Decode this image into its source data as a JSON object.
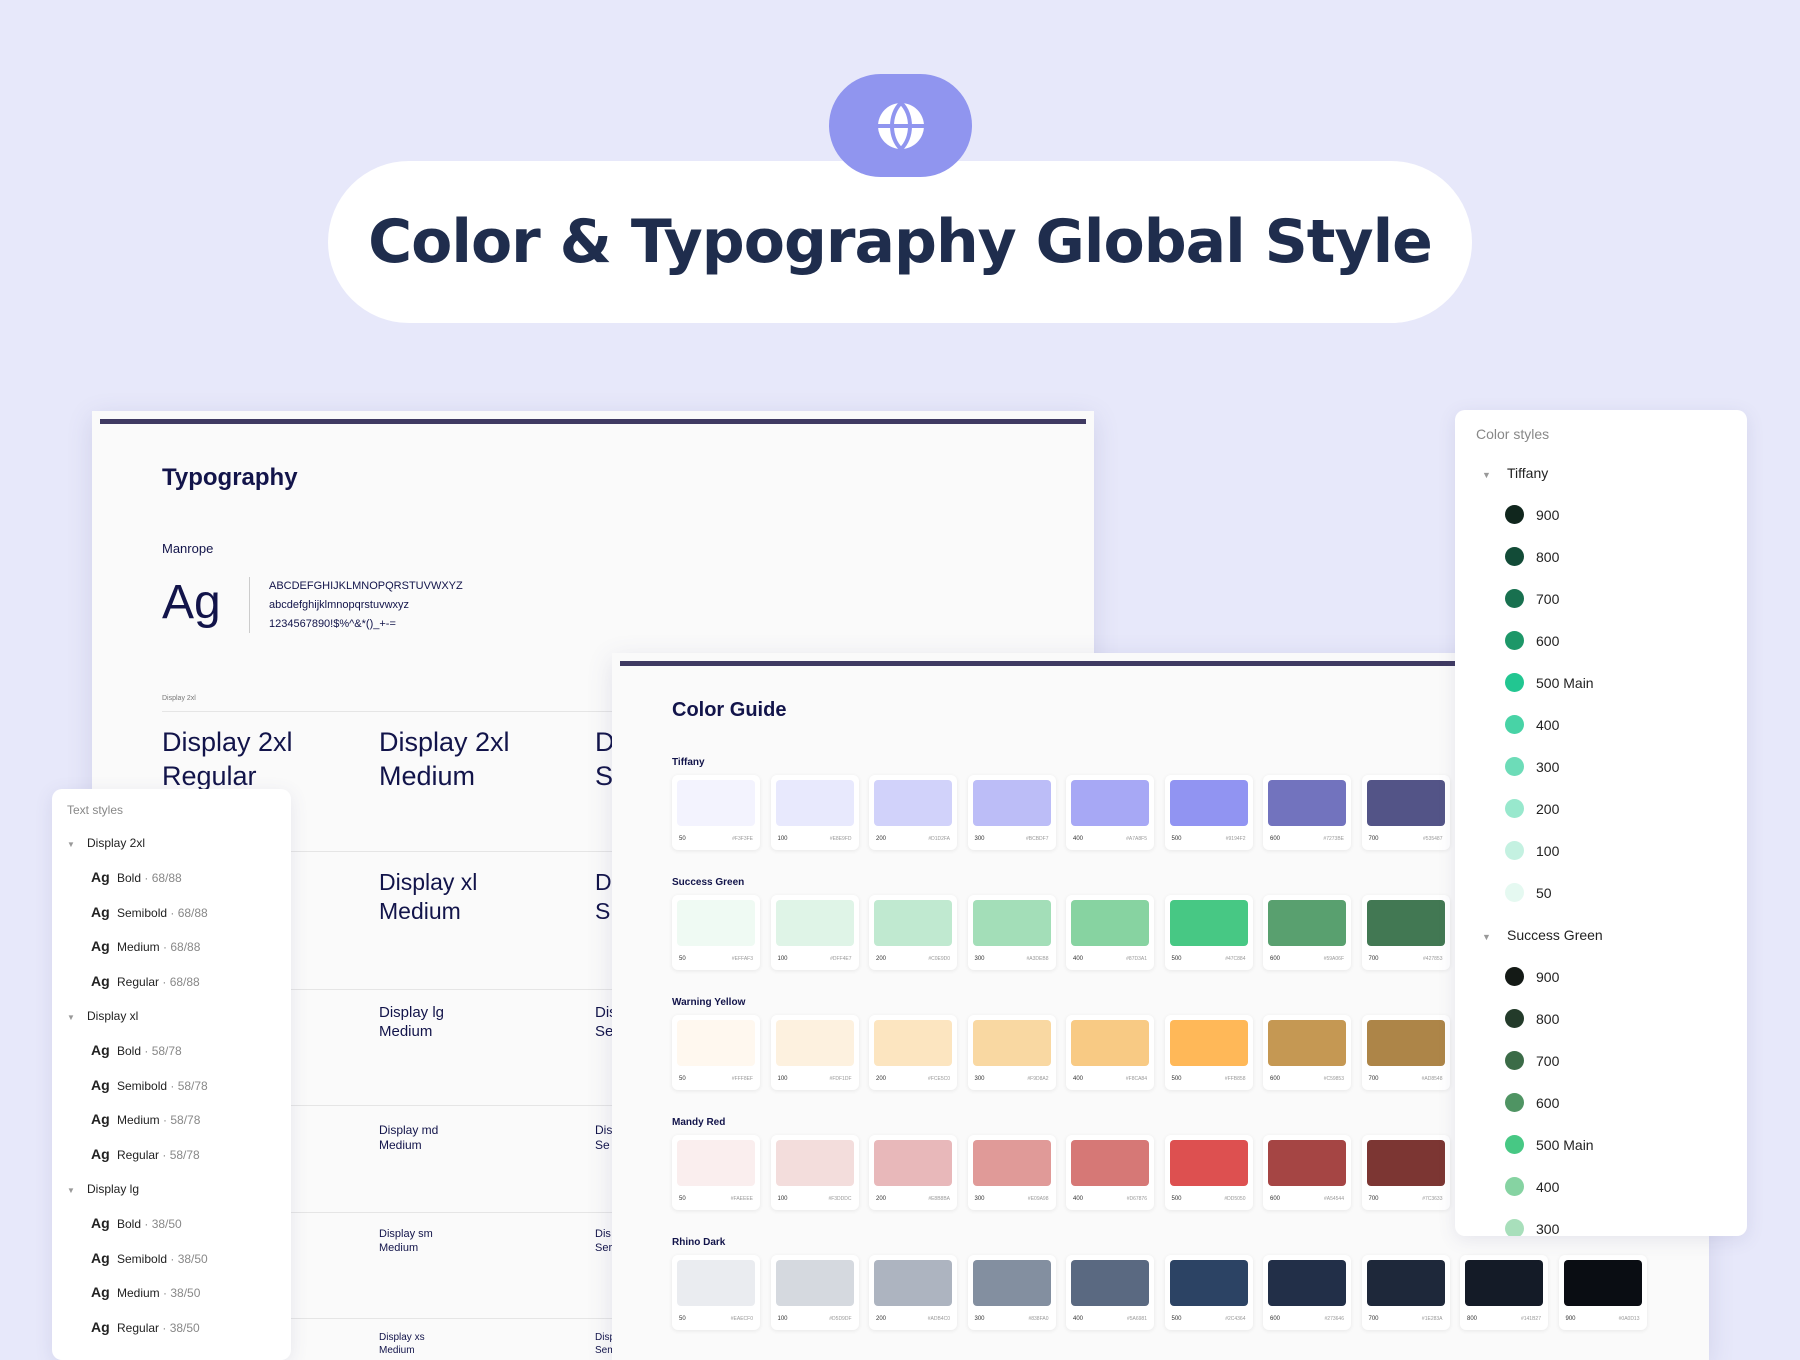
{
  "header": {
    "title": "Color & Typography Global Style",
    "icon": "globe-icon",
    "icon_color": "#9095ef"
  },
  "typography": {
    "title": "Typography",
    "font_name": "Manrope",
    "sample_glyph": "Ag",
    "uppercase": "ABCDEFGHIJKLMNOPQRSTUVWXYZ",
    "lowercase": "abcdefghijklmnopqrstuvwxyz",
    "symbols": "1234567890!$%^&*()_+-=",
    "section_label": "Display 2xl",
    "rows": {
      "d2_regular_1": "Display 2xl",
      "d2_regular_2": "Regular",
      "d2_medium_1": "Display 2xl",
      "d2_medium_2": "Medium",
      "d2_semi_1": "D",
      "d2_semi_2": "S",
      "d1_medium_1": "Display xl",
      "d1_medium_2": "Medium",
      "d1_semi_1": "D",
      "d1_semi_2": "S",
      "dlg_medium_1": "Display lg",
      "dlg_medium_2": "Medium",
      "dlg_semi_1": "Dis",
      "dlg_semi_2": "Se",
      "dmd_medium_1": "Display md",
      "dmd_medium_2": "Medium",
      "dmd_semi_1": "Dis",
      "dmd_semi_2": "Se",
      "dsm_medium_1": "Display sm",
      "dsm_medium_2": "Medium",
      "dsm_semi_1": "Dis",
      "dsm_semi_2": "Ser",
      "dxs_medium_1": "Display xs",
      "dxs_medium_2": "Medium",
      "dxs_semi_1": "Disp",
      "dxs_semi_2": "Sem"
    }
  },
  "text_styles": {
    "header": "Text styles",
    "groups": [
      {
        "name": "Display 2xl",
        "items": [
          {
            "glyph": "Ag",
            "weight": "Bold",
            "size": " · 68/88"
          },
          {
            "glyph": "Ag",
            "weight": "Semibold",
            "size": " · 68/88"
          },
          {
            "glyph": "Ag",
            "weight": "Medium",
            "size": " · 68/88"
          },
          {
            "glyph": "Ag",
            "weight": "Regular",
            "size": " · 68/88"
          }
        ]
      },
      {
        "name": "Display xl",
        "items": [
          {
            "glyph": "Ag",
            "weight": "Bold",
            "size": " · 58/78"
          },
          {
            "glyph": "Ag",
            "weight": "Semibold",
            "size": " · 58/78"
          },
          {
            "glyph": "Ag",
            "weight": "Medium",
            "size": " · 58/78"
          },
          {
            "glyph": "Ag",
            "weight": "Regular",
            "size": " · 58/78"
          }
        ]
      },
      {
        "name": "Display lg",
        "items": [
          {
            "glyph": "Ag",
            "weight": "Bold",
            "size": " · 38/50"
          },
          {
            "glyph": "Ag",
            "weight": "Semibold",
            "size": " · 38/50"
          },
          {
            "glyph": "Ag",
            "weight": "Medium",
            "size": " · 38/50"
          },
          {
            "glyph": "Ag",
            "weight": "Regular",
            "size": " · 38/50"
          }
        ]
      }
    ]
  },
  "color_guide": {
    "title": "Color Guide",
    "sections": [
      {
        "name": "Tiffany",
        "swatches": [
          {
            "n": "50",
            "hex": "#F3F3FE",
            "color": "#f3f3fe"
          },
          {
            "n": "100",
            "hex": "#E8E9FD",
            "color": "#e8e9fd"
          },
          {
            "n": "200",
            "hex": "#D1D2FA",
            "color": "#d1d2fa"
          },
          {
            "n": "300",
            "hex": "#BCBDF7",
            "color": "#bcbdf7"
          },
          {
            "n": "400",
            "hex": "#A7A8F5",
            "color": "#a7a8f5"
          },
          {
            "n": "500",
            "hex": "#9194F2",
            "color": "#9194f2"
          },
          {
            "n": "600",
            "hex": "#7273BE",
            "color": "#7273be"
          },
          {
            "n": "700",
            "hex": "#535487",
            "color": "#535487"
          }
        ]
      },
      {
        "name": "Success Green",
        "swatches": [
          {
            "n": "50",
            "hex": "#EFFAF3",
            "color": "#effaf3"
          },
          {
            "n": "100",
            "hex": "#DFF4E7",
            "color": "#dff4e7"
          },
          {
            "n": "200",
            "hex": "#C0E9D0",
            "color": "#c0e9d0"
          },
          {
            "n": "300",
            "hex": "#A3DEB8",
            "color": "#a3deb8"
          },
          {
            "n": "400",
            "hex": "#87D3A1",
            "color": "#87d3a1"
          },
          {
            "n": "500",
            "hex": "#47C884",
            "color": "#47c884"
          },
          {
            "n": "600",
            "hex": "#59A06F",
            "color": "#59a06f"
          },
          {
            "n": "700",
            "hex": "#427853",
            "color": "#427853"
          }
        ]
      },
      {
        "name": "Warning Yellow",
        "swatches": [
          {
            "n": "50",
            "hex": "#FFF8EF",
            "color": "#fff8ef"
          },
          {
            "n": "100",
            "hex": "#FDF1DF",
            "color": "#fdf1df"
          },
          {
            "n": "200",
            "hex": "#FCE5C0",
            "color": "#fce5c0"
          },
          {
            "n": "300",
            "hex": "#F9D8A2",
            "color": "#f9d8a2"
          },
          {
            "n": "400",
            "hex": "#F8CA84",
            "color": "#f8ca84"
          },
          {
            "n": "500",
            "hex": "#FFB858",
            "color": "#ffb858"
          },
          {
            "n": "600",
            "hex": "#C59853",
            "color": "#c59853"
          },
          {
            "n": "700",
            "hex": "#AD8548",
            "color": "#ad8548"
          }
        ]
      },
      {
        "name": "Mandy Red",
        "swatches": [
          {
            "n": "50",
            "hex": "#FAEEEE",
            "color": "#faeeee"
          },
          {
            "n": "100",
            "hex": "#F3DDDC",
            "color": "#f3dddc"
          },
          {
            "n": "200",
            "hex": "#E8B8BA",
            "color": "#e8b8ba"
          },
          {
            "n": "300",
            "hex": "#E09A98",
            "color": "#e09a98"
          },
          {
            "n": "400",
            "hex": "#D67876",
            "color": "#d67876"
          },
          {
            "n": "500",
            "hex": "#DD5050",
            "color": "#dd5050"
          },
          {
            "n": "600",
            "hex": "#A54544",
            "color": "#a54544"
          },
          {
            "n": "700",
            "hex": "#7C3633",
            "color": "#7c3633"
          }
        ]
      },
      {
        "name": "Rhino Dark",
        "swatches": [
          {
            "n": "50",
            "hex": "#EAECF0",
            "color": "#eaecf0"
          },
          {
            "n": "100",
            "hex": "#D5D9DF",
            "color": "#d5d9df"
          },
          {
            "n": "200",
            "hex": "#ADB4C0",
            "color": "#adb4c0"
          },
          {
            "n": "300",
            "hex": "#838FA0",
            "color": "#838fa0"
          },
          {
            "n": "400",
            "hex": "#5A6981",
            "color": "#5a6981"
          },
          {
            "n": "500",
            "hex": "#2C4364",
            "color": "#2c4364"
          },
          {
            "n": "600",
            "hex": "#273646",
            "color": "#222f48"
          },
          {
            "n": "700",
            "hex": "#1E283A",
            "color": "#1e283a"
          },
          {
            "n": "800",
            "hex": "#141B27",
            "color": "#141b27"
          },
          {
            "n": "900",
            "hex": "#0A0D13",
            "color": "#0a0d13"
          }
        ]
      }
    ]
  },
  "color_styles": {
    "header": "Color styles",
    "groups": [
      {
        "name": "Tiffany",
        "items": [
          {
            "label": "900",
            "color": "#10261d"
          },
          {
            "label": "800",
            "color": "#124b37"
          },
          {
            "label": "700",
            "color": "#18704f"
          },
          {
            "label": "600",
            "color": "#1d9768"
          },
          {
            "label": "500 Main",
            "color": "#22c691"
          },
          {
            "label": "400",
            "color": "#48d3a6"
          },
          {
            "label": "300",
            "color": "#6ddcb8"
          },
          {
            "label": "200",
            "color": "#98e8cd"
          },
          {
            "label": "100",
            "color": "#c4f1e1"
          },
          {
            "label": "50",
            "color": "#e5f9f1"
          }
        ]
      },
      {
        "name": "Success Green",
        "items": [
          {
            "label": "900",
            "color": "#141a16"
          },
          {
            "label": "800",
            "color": "#233b2a"
          },
          {
            "label": "700",
            "color": "#3b6b47"
          },
          {
            "label": "600",
            "color": "#4f9463"
          },
          {
            "label": "500 Main",
            "color": "#47c884"
          },
          {
            "label": "400",
            "color": "#86d3a2"
          },
          {
            "label": "300",
            "color": "#a8dfbb"
          }
        ]
      }
    ]
  }
}
